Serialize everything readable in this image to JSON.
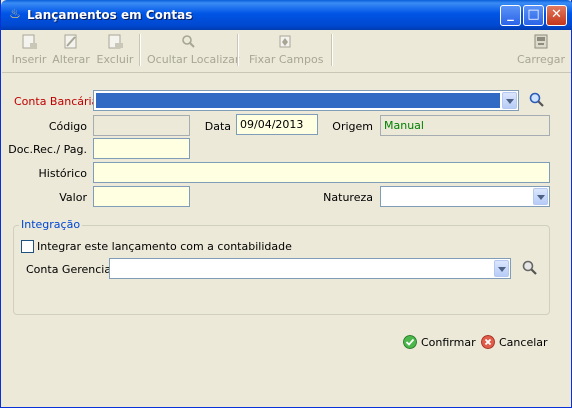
{
  "window": {
    "title": "Lançamentos em Contas",
    "controls": {
      "minimize": "_",
      "maximize": "□",
      "close": "✕"
    }
  },
  "toolbar": {
    "inserir": "Inserir",
    "alterar": "Alterar",
    "excluir": "Excluir",
    "ocultar_localizar": "Ocultar Localizar",
    "fixar_campos": "Fixar Campos",
    "carregar": "Carregar"
  },
  "form": {
    "conta_bancaria_label": "Conta Bancária",
    "codigo_label": "Código",
    "codigo_value": "",
    "data_label": "Data",
    "data_value": "09/04/2013",
    "origem_label": "Origem",
    "origem_value": "Manual",
    "doc_label": "Doc.Rec./ Pag.",
    "doc_value": "",
    "historico_label": "Histórico",
    "historico_value": "",
    "valor_label": "Valor",
    "valor_value": "",
    "natureza_label": "Natureza",
    "natureza_value": ""
  },
  "integracao": {
    "legend": "Integração",
    "checkbox_label": "Integrar este lançamento com a contabilidade",
    "checked": false,
    "conta_gerencial_label": "Conta Gerencial",
    "conta_gerencial_value": ""
  },
  "actions": {
    "confirmar": "Confirmar",
    "cancelar": "Cancelar"
  },
  "colors": {
    "required_label": "#c00000",
    "origem_text": "#008000",
    "legend": "#0046d5",
    "selection": "#316ac5"
  },
  "icons": [
    "app-icon",
    "insert-icon",
    "edit-icon",
    "delete-icon",
    "search-icon",
    "pin-icon",
    "load-icon",
    "confirm-icon",
    "cancel-icon"
  ]
}
